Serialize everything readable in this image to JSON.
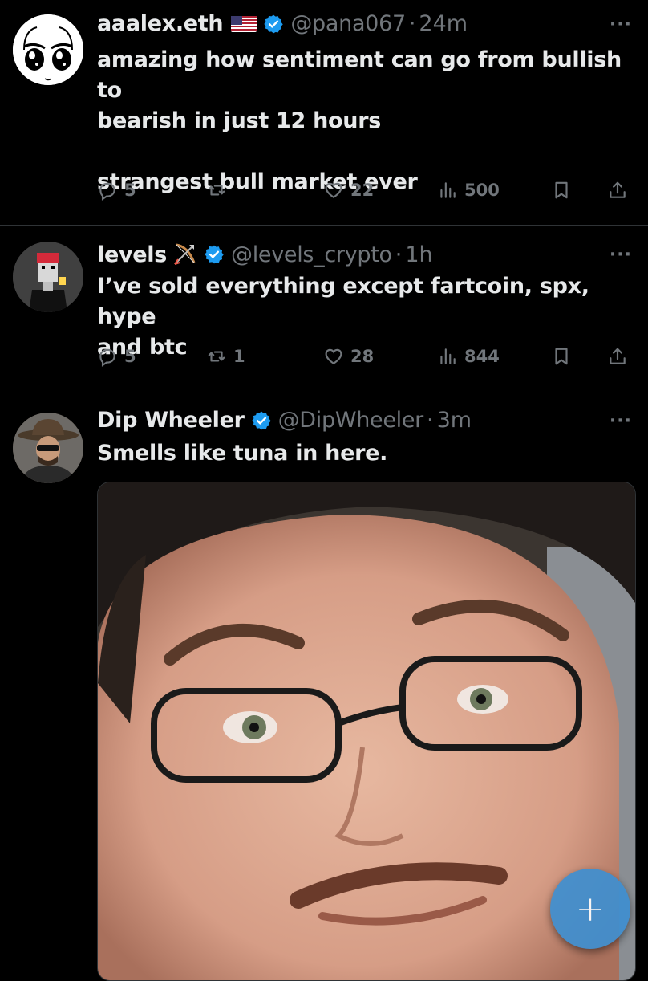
{
  "tweets": [
    {
      "name": "aaalex.eth",
      "handle": "@pana067",
      "sep": "·",
      "time": "24m",
      "text_lines": [
        "amazing how sentiment can go from bullish to",
        "bearish in just 12 hours",
        "",
        "strangest bull market ever"
      ],
      "replies": "5",
      "reposts": "",
      "likes": "22",
      "views": "500"
    },
    {
      "name": "levels",
      "handle": "@levels_crypto",
      "sep": "·",
      "time": "1h",
      "text_lines": [
        "I’ve sold everything except fartcoin, spx, hype",
        "and btc"
      ],
      "replies": "5",
      "reposts": "1",
      "likes": "28",
      "views": "844"
    },
    {
      "name": "Dip Wheeler",
      "handle": "@DipWheeler",
      "sep": "·",
      "time": "3m",
      "text_lines": [
        "Smells like tuna in here."
      ]
    }
  ],
  "more_label": "···",
  "fab_label": "+",
  "colors": {
    "background": "#000000",
    "text": "#e7e9ea",
    "muted": "#71767b",
    "verified": "#1d9bf0",
    "fab": "#3f8fd0"
  },
  "icons": [
    "reply-icon",
    "repost-icon",
    "like-icon",
    "views-icon",
    "bookmark-icon",
    "share-icon",
    "verified-icon",
    "more-icon",
    "compose-icon"
  ]
}
